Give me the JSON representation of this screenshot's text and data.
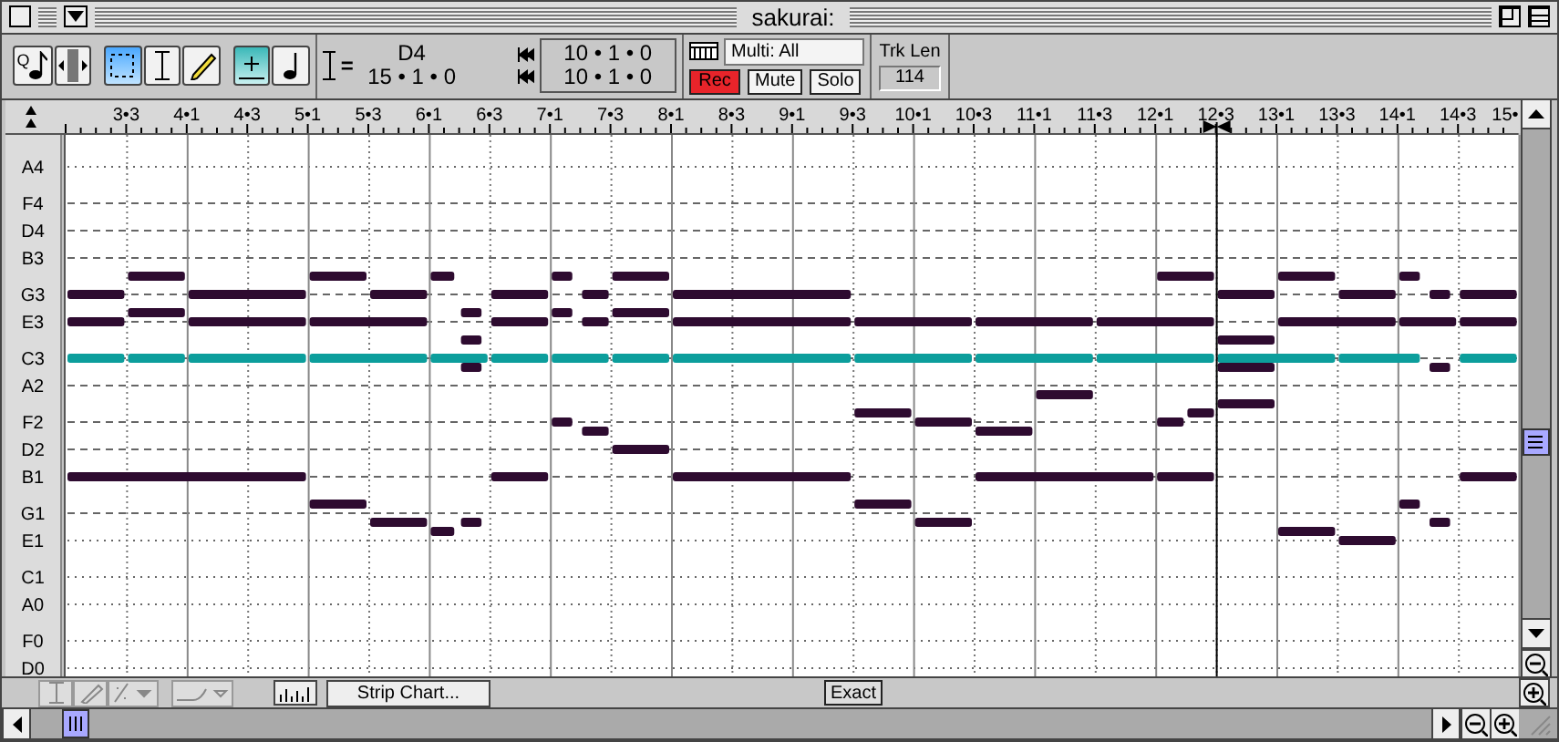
{
  "window": {
    "title": "sakurai:"
  },
  "toolbar": {
    "tools": [
      {
        "kind": "quantize",
        "label": "Q",
        "selected": false
      },
      {
        "kind": "slider",
        "selected": false
      },
      {
        "kind": "marquee",
        "selected": true
      },
      {
        "kind": "ibeam",
        "selected": false
      },
      {
        "kind": "pencil",
        "selected": false
      },
      {
        "kind": "grid",
        "selected": true
      },
      {
        "kind": "note",
        "selected": false
      }
    ],
    "position": {
      "sign": "=",
      "pitch": "D4",
      "time": "15 • 1 • 0",
      "start": "10 • 1 • 0",
      "end": "10 • 1 • 0"
    },
    "track": {
      "name": "Multi: All",
      "buttons": [
        {
          "label": "Rec",
          "on": true
        },
        {
          "label": "Mute",
          "on": false
        },
        {
          "label": "Solo",
          "on": false
        }
      ]
    },
    "track_length": {
      "label": "Trk Len",
      "value": "114"
    }
  },
  "editor": {
    "ruler_labels": [
      "3•3",
      "4•1",
      "4•3",
      "5•1",
      "5•3",
      "6•1",
      "6•3",
      "7•1",
      "7•3",
      "8•1",
      "8•3",
      "9•1",
      "9•3",
      "10•1",
      "10•3",
      "11•1",
      "11•3",
      "12•1",
      "12•3",
      "13•1",
      "13•3",
      "14•1",
      "14•3",
      "15•"
    ],
    "pitch_labels": [
      "A4",
      "F4",
      "D4",
      "B3",
      "G3",
      "E3",
      "C3",
      "A2",
      "F2",
      "D2",
      "B1",
      "G1",
      "E1",
      "C1",
      "A0",
      "F0",
      "D0"
    ],
    "playhead": true,
    "notes": [
      {
        "selected": false
      },
      {
        "selected": false
      },
      {
        "selected": false
      },
      {
        "selected": false
      },
      {
        "selected": false
      },
      {
        "selected": false
      },
      {
        "selected": false
      },
      {
        "selected": false
      },
      {
        "selected": false
      },
      {
        "selected": false
      },
      {
        "selected": false
      },
      {
        "selected": false
      },
      {
        "selected": false
      },
      {
        "selected": false
      },
      {
        "selected": false
      },
      {
        "selected": false
      },
      {
        "selected": false
      },
      {
        "selected": false
      },
      {
        "selected": false
      },
      {
        "selected": false
      },
      {
        "selected": false
      },
      {
        "selected": false
      },
      {
        "selected": false
      },
      {
        "selected": false
      },
      {
        "selected": false
      },
      {
        "selected": false
      },
      {
        "selected": false
      },
      {
        "selected": false
      },
      {
        "selected": false
      },
      {
        "selected": false
      },
      {
        "selected": false
      },
      {
        "selected": false
      },
      {
        "selected": false
      },
      {
        "selected": false
      },
      {
        "selected": false
      },
      {
        "selected": false
      },
      {
        "selected": false
      },
      {
        "selected": false
      },
      {
        "selected": false
      },
      {
        "selected": false
      },
      {
        "selected": false
      },
      {
        "selected": false
      },
      {
        "selected": false
      },
      {
        "selected": false
      },
      {
        "selected": false
      },
      {
        "selected": false
      },
      {
        "selected": false
      },
      {
        "selected": false
      },
      {
        "selected": false
      },
      {
        "selected": false
      },
      {
        "selected": false
      },
      {
        "selected": false
      },
      {
        "selected": false
      },
      {
        "selected": false
      },
      {
        "selected": false
      },
      {
        "selected": false
      },
      {
        "selected": false
      },
      {
        "selected": false
      },
      {
        "selected": false
      },
      {
        "selected": false
      },
      {
        "selected": false
      },
      {
        "selected": false
      },
      {
        "selected": false
      },
      {
        "selected": false
      },
      {
        "selected": false
      },
      {
        "selected": true
      },
      {
        "selected": true
      },
      {
        "selected": true
      },
      {
        "selected": true
      },
      {
        "selected": true
      },
      {
        "selected": true
      },
      {
        "selected": true
      },
      {
        "selected": true
      },
      {
        "selected": true
      },
      {
        "selected": true
      },
      {
        "selected": true
      },
      {
        "selected": true
      },
      {
        "selected": true
      },
      {
        "selected": true
      },
      {
        "selected": true
      }
    ]
  },
  "bottom": {
    "strip_chart": "Strip Chart...",
    "exact": "Exact"
  }
}
